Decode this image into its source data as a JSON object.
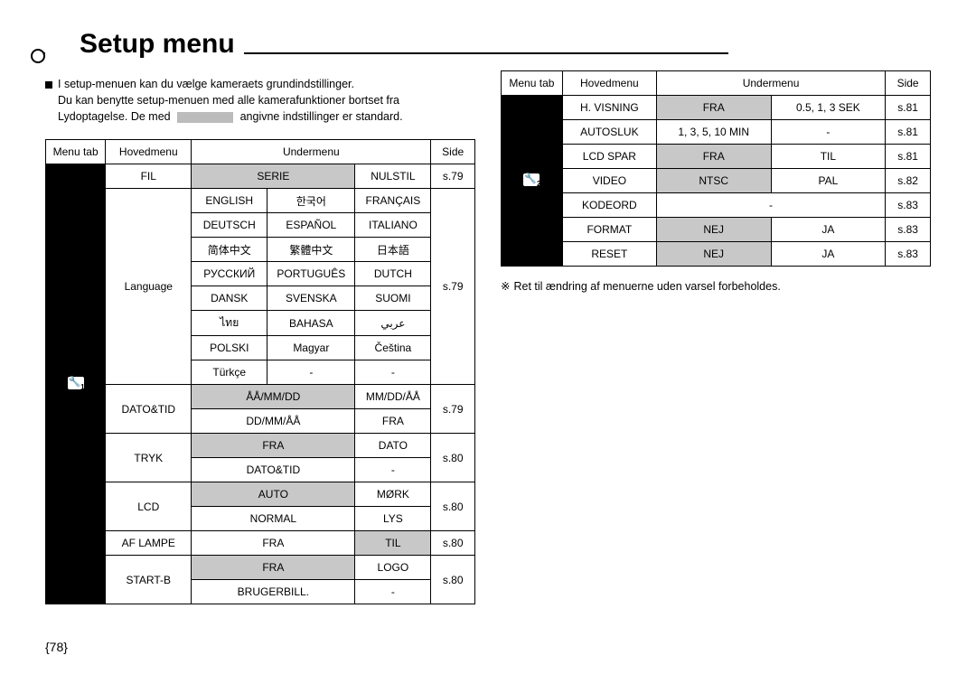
{
  "title": "Setup menu",
  "intro_l1": "I setup-menuen kan du vælge kameraets grundindstillinger.",
  "intro_l2a": "Du kan benytte setup-menuen med alle kamerafunktioner bortset fra",
  "intro_l2b": "Lydoptagelse. De med",
  "intro_l2c": "angivne indstillinger er standard.",
  "hdr": {
    "tab": "Menu tab",
    "main": "Hovedmenu",
    "sub": "Undermenu",
    "page": "Side"
  },
  "t1": {
    "icon_sub": "1",
    "fil": {
      "label": "FIL",
      "serie": "SERIE",
      "nulstil": "NULSTIL",
      "page": "s.79"
    },
    "lang": {
      "label": "Language",
      "page": "s.79",
      "r": [
        [
          "ENGLISH",
          "한국어",
          "FRANÇAIS"
        ],
        [
          "DEUTSCH",
          "ESPAÑOL",
          "ITALIANO"
        ],
        [
          "简体中文",
          "繁體中文",
          "日本語"
        ],
        [
          "РУССКИЙ",
          "PORTUGUÊS",
          "DUTCH"
        ],
        [
          "DANSK",
          "SVENSKA",
          "SUOMI"
        ],
        [
          "ไทย",
          "BAHASA",
          "عربي"
        ],
        [
          "POLSKI",
          "Magyar",
          "Čeština"
        ],
        [
          "Türkçe",
          "-",
          "-"
        ]
      ]
    },
    "dato": {
      "label": "DATO&TID",
      "a": "ÅÅ/MM/DD",
      "b": "MM/DD/ÅÅ",
      "c": "DD/MM/ÅÅ",
      "d": "FRA",
      "page": "s.79"
    },
    "tryk": {
      "label": "TRYK",
      "a": "FRA",
      "b": "DATO",
      "c": "DATO&TID",
      "d": "-",
      "page": "s.80"
    },
    "lcd": {
      "label": "LCD",
      "a": "AUTO",
      "b": "MØRK",
      "c": "NORMAL",
      "d": "LYS",
      "page": "s.80"
    },
    "af": {
      "label": "AF LAMPE",
      "a": "FRA",
      "b": "TIL",
      "page": "s.80"
    },
    "startb": {
      "label": "START-B",
      "a": "FRA",
      "b": "LOGO",
      "c": "BRUGERBILL.",
      "d": "-",
      "page": "s.80"
    }
  },
  "t2": {
    "icon_sub": "2",
    "rows": [
      {
        "m": "H. VISNING",
        "a": "FRA",
        "a_dfl": true,
        "b": "0.5, 1, 3 SEK",
        "p": "s.81"
      },
      {
        "m": "AUTOSLUK",
        "a": "1, 3, 5, 10 MIN",
        "a_dfl": false,
        "b": "-",
        "p": "s.81"
      },
      {
        "m": "LCD SPAR",
        "a": "FRA",
        "a_dfl": true,
        "b": "TIL",
        "p": "s.81"
      },
      {
        "m": "VIDEO",
        "a": "NTSC",
        "a_dfl": true,
        "b": "PAL",
        "p": "s.82"
      },
      {
        "m": "KODEORD",
        "a_span": "-",
        "p": "s.83"
      },
      {
        "m": "FORMAT",
        "a": "NEJ",
        "a_dfl": true,
        "b": "JA",
        "p": "s.83"
      },
      {
        "m": "RESET",
        "a": "NEJ",
        "a_dfl": true,
        "b": "JA",
        "p": "s.83"
      }
    ]
  },
  "footnote": "Ret til ændring af menuerne uden varsel forbeholdes.",
  "pagenum": "{78}"
}
